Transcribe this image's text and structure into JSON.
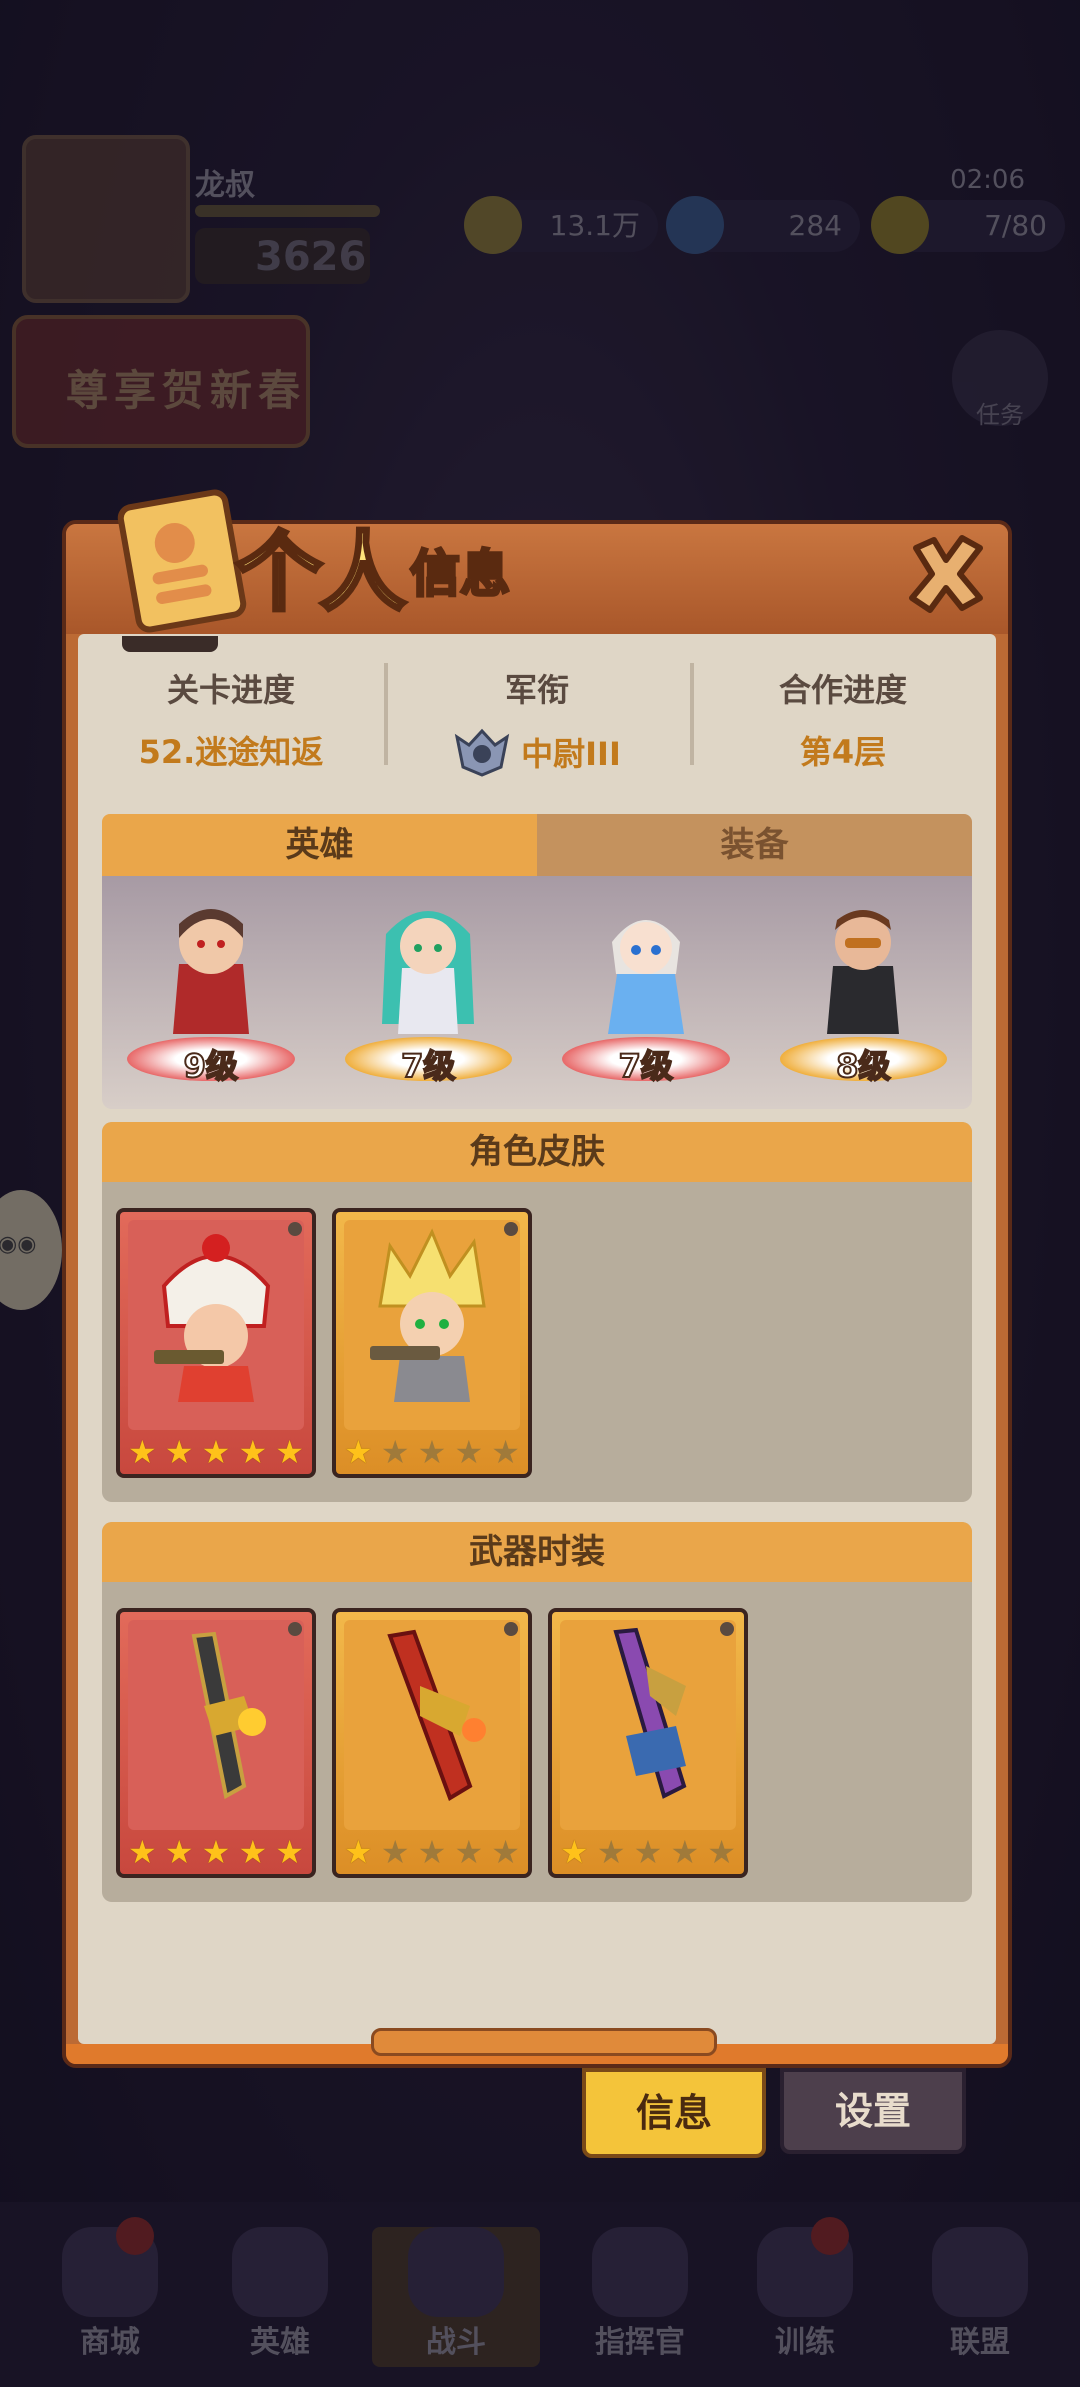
{
  "hud": {
    "player_name": "龙叔",
    "power": "3626",
    "gold": "13.1万",
    "gems": "284",
    "energy": "7/80",
    "timer": "02:06",
    "banner": "尊享贺新春",
    "task_label": "任务"
  },
  "dialog": {
    "title_big": "个人",
    "title_small": "信息",
    "stats": [
      {
        "label": "关卡进度",
        "value": "52.迷途知返"
      },
      {
        "label": "军衔",
        "value": "中尉III"
      },
      {
        "label": "合作进度",
        "value": "第4层"
      }
    ],
    "tabs": [
      {
        "label": "英雄",
        "active": true
      },
      {
        "label": "装备",
        "active": false
      }
    ],
    "heroes": [
      {
        "level": "9级",
        "ring": "red"
      },
      {
        "level": "7级",
        "ring": "gold"
      },
      {
        "level": "7级",
        "ring": "red"
      },
      {
        "level": "8级",
        "ring": "gold"
      }
    ],
    "skins_title": "角色皮肤",
    "skins": [
      {
        "bg": "red",
        "stars": 5
      },
      {
        "bg": "gold",
        "stars": 1
      }
    ],
    "weapons_title": "武器时装",
    "weapons": [
      {
        "bg": "red",
        "stars": 5
      },
      {
        "bg": "gold",
        "stars": 1
      },
      {
        "bg": "gold",
        "stars": 1
      }
    ]
  },
  "bottom_tabs": {
    "info": "信息",
    "settings": "设置"
  },
  "nav": [
    "商城",
    "英雄",
    "战斗",
    "指挥官",
    "训练",
    "联盟"
  ],
  "colors": {
    "accent": "#eaa64a",
    "stat_value": "#c27a1c",
    "panel": "#dfd6c6"
  }
}
